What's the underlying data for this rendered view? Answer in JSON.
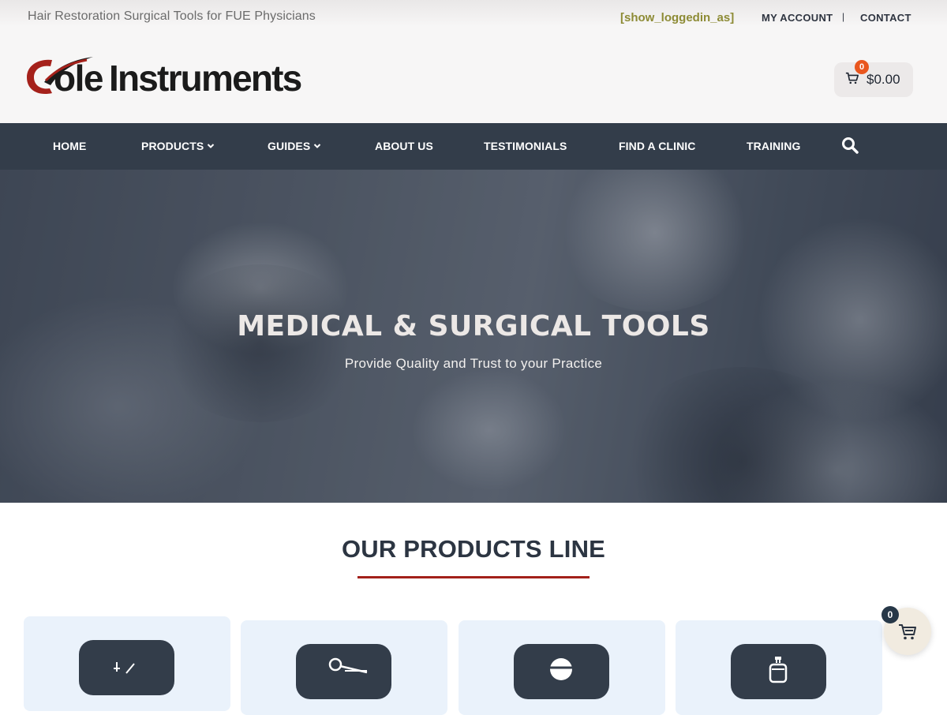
{
  "topbar": {
    "tagline": "Hair Restoration Surgical Tools for FUE Physicians",
    "loggedin": "[show_loggedin_as]",
    "my_account": "MY ACCOUNT",
    "separator": "|",
    "contact": "CONTACT"
  },
  "header": {
    "logo_letter": "C",
    "logo_ole": "ole",
    "logo_instruments": "Instruments",
    "cart_count": "0",
    "cart_total": "$0.00"
  },
  "nav": {
    "items": [
      {
        "label": "HOME"
      },
      {
        "label": "PRODUCTS"
      },
      {
        "label": "GUIDES"
      },
      {
        "label": "ABOUT US"
      },
      {
        "label": "TESTIMONIALS"
      },
      {
        "label": "FIND A CLINIC"
      },
      {
        "label": "TRAINING"
      }
    ]
  },
  "hero": {
    "title": "MEDICAL & SURGICAL TOOLS",
    "subtitle": "Provide Quality and Trust to your Practice"
  },
  "products": {
    "title": "OUR PRODUCTS LINE",
    "cards": [
      {
        "icon": "needle-tool-icon"
      },
      {
        "icon": "scissors-tool-icon"
      },
      {
        "icon": "lens-tool-icon"
      },
      {
        "icon": "spray-bottle-icon"
      }
    ]
  },
  "floating_cart": {
    "count": "0"
  },
  "colors": {
    "nav_bg": "#333d4a",
    "accent_red": "#a3201a",
    "badge_orange": "#e9561e",
    "loggedin_olive": "#8d8b35",
    "card_bg": "#eaf2fb"
  }
}
